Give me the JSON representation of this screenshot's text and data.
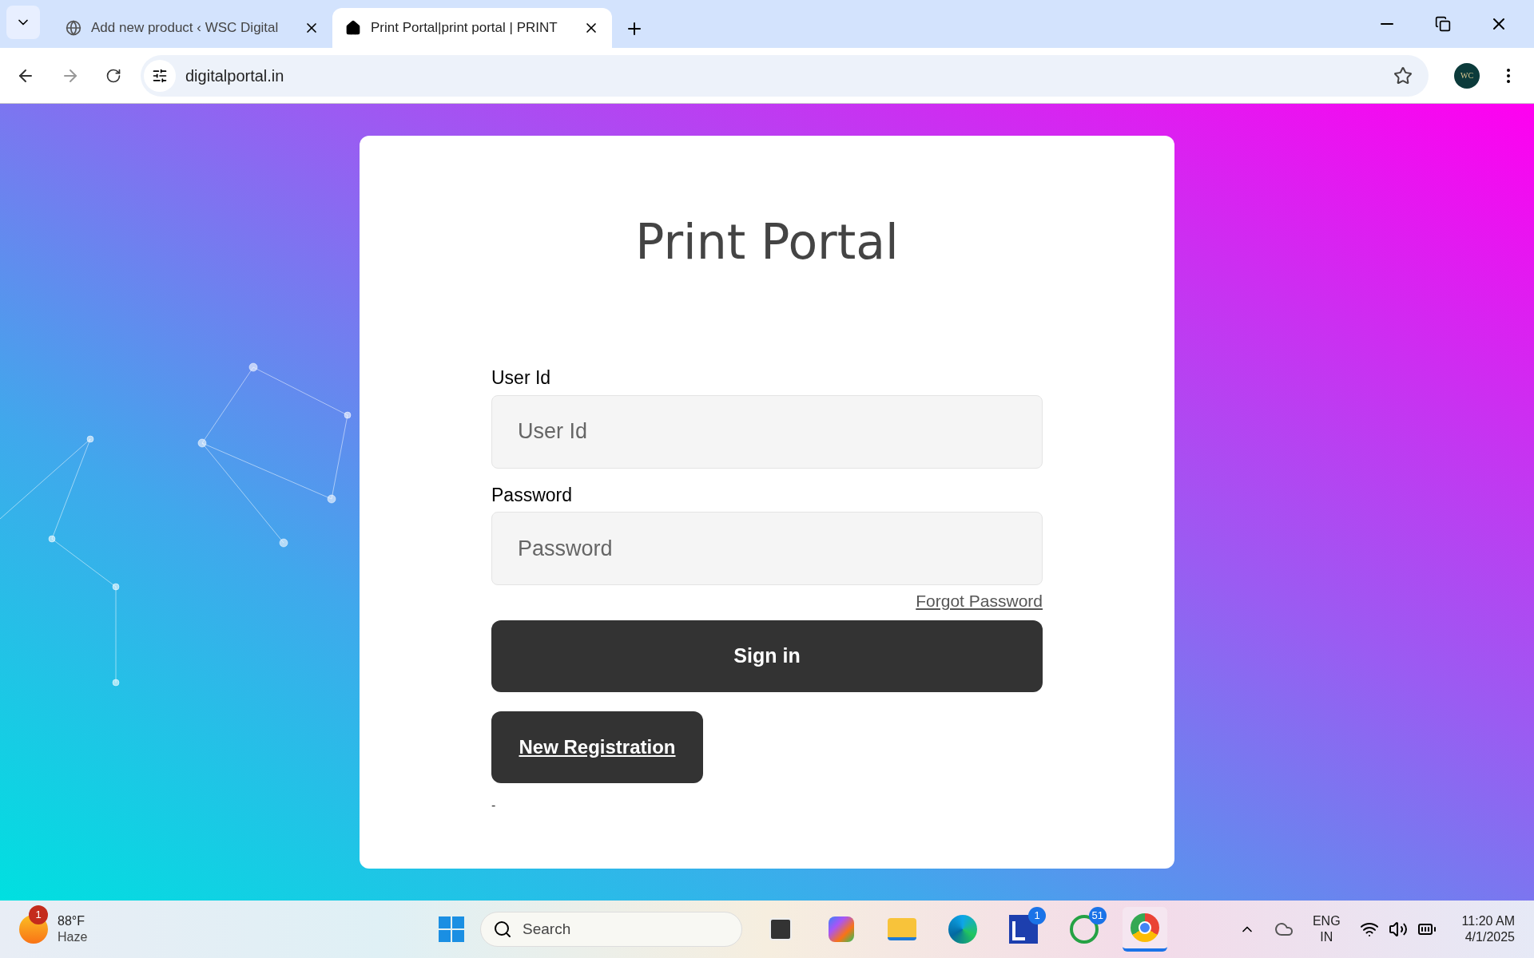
{
  "browser": {
    "tabs": [
      {
        "title": "Add new product ‹ WSC Digital",
        "kind": "globe",
        "selected": false
      },
      {
        "title": "Print Portal|print portal | PRINT",
        "kind": "home",
        "selected": true
      }
    ],
    "address": "digitalportal.in",
    "profile": "WC"
  },
  "login": {
    "title": "Print Portal",
    "fields": [
      {
        "label": "User Id",
        "placeholder": "User Id"
      },
      {
        "label": "Password",
        "placeholder": "Password"
      }
    ],
    "forgot_link": "Forgot Password",
    "sign_in": "Sign in",
    "register": "New Registration",
    "footer": "-"
  },
  "taskbar": {
    "weather": {
      "temp": "88°F",
      "condition": "Haze",
      "badge": "1"
    },
    "search": {
      "placeholder": "Search"
    },
    "apps": [
      {
        "kind": "task-view",
        "selected": false
      },
      {
        "kind": "copilot",
        "selected": false
      },
      {
        "kind": "folder",
        "selected": false
      },
      {
        "kind": "edge",
        "selected": false
      },
      {
        "kind": "l-app",
        "badge": "1",
        "selected": false
      },
      {
        "kind": "whatsapp",
        "badge": "51",
        "selected": false
      },
      {
        "kind": "chrome",
        "selected": true
      }
    ],
    "language": [
      "ENG",
      "IN"
    ],
    "time": "11:20 AM",
    "date": "4/1/2025"
  }
}
